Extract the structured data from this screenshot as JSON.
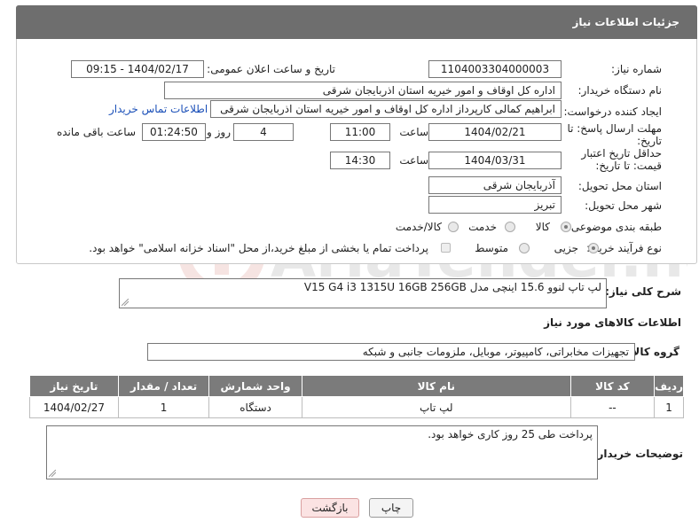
{
  "header": {
    "title": "جزئیات اطلاعات نیاز"
  },
  "form": {
    "need_number_label": "شماره نیاز:",
    "need_number": "1104003304000003",
    "announce_label": "تاریخ و ساعت اعلان عمومی:",
    "announce_value": "1404/02/17 - 09:15",
    "buyer_org_label": "نام دستگاه خریدار:",
    "buyer_org": "اداره کل اوقاف و امور خیریه استان اذربایجان شرقی",
    "requester_label": "ایجاد کننده درخواست:",
    "requester": "ابراهیم کمالی کارپرداز اداره کل اوقاف و امور خیریه استان اذربایجان شرقی",
    "contact_link": "اطلاعات تماس خریدار",
    "reply_deadline_label": "مهلت ارسال پاسخ: تا تاریخ:",
    "reply_date": "1404/02/21",
    "time_label": "ساعت",
    "reply_time": "11:00",
    "days_value": "4",
    "days_label": "روز و",
    "remaining_time": "01:24:50",
    "remaining_label": "ساعت باقی مانده",
    "price_validity_label": "حداقل تاریخ اعتبار قیمت: تا تاریخ:",
    "price_date": "1404/03/31",
    "price_time": "14:30",
    "province_label": "استان محل تحویل:",
    "province": "آذربایجان شرقی",
    "city_label": "شهر محل تحویل:",
    "city": "تبریز",
    "category_label": "طبقه بندی موضوعی:",
    "category_options": [
      "کالا",
      "خدمت",
      "کالا/خدمت"
    ],
    "process_label": "نوع فرآیند خرید :",
    "process_options": [
      "جزیی",
      "متوسط"
    ],
    "payment_note": "پرداخت تمام یا بخشی از مبلغ خرید،از محل \"اسناد خزانه اسلامی\" خواهد بود."
  },
  "description": {
    "label": "شرح کلی نیاز:",
    "value": "لپ تاپ لنوو 15.6 اینچی مدل V15 G4 i3 1315U 16GB 256GB"
  },
  "goods": {
    "section_title": "اطلاعات کالاهای مورد نیاز",
    "group_label": "گروه کالا:",
    "group_value": "تجهیزات مخابراتی، کامپیوتر، موبایل، ملزومات جانبی و شبکه",
    "columns": [
      "ردیف",
      "کد کالا",
      "نام کالا",
      "واحد شمارش",
      "تعداد / مقدار",
      "تاریخ نیاز"
    ],
    "rows": [
      [
        "1",
        "--",
        "لپ تاپ",
        "دستگاه",
        "1",
        "1404/02/27"
      ]
    ]
  },
  "buyer_notes": {
    "label": "توضیحات خریدار:",
    "value": "پرداخت طی 25 روز کاری خواهد بود."
  },
  "buttons": {
    "print": "چاپ",
    "back": "بازگشت"
  },
  "watermark": {
    "text": "AriaTender.neT"
  },
  "colors": {
    "header_bg": "#6e6e6e",
    "table_head": "#7b7b7b",
    "link": "#1a4fb8",
    "back_btn_bg": "#fbe3e3"
  }
}
